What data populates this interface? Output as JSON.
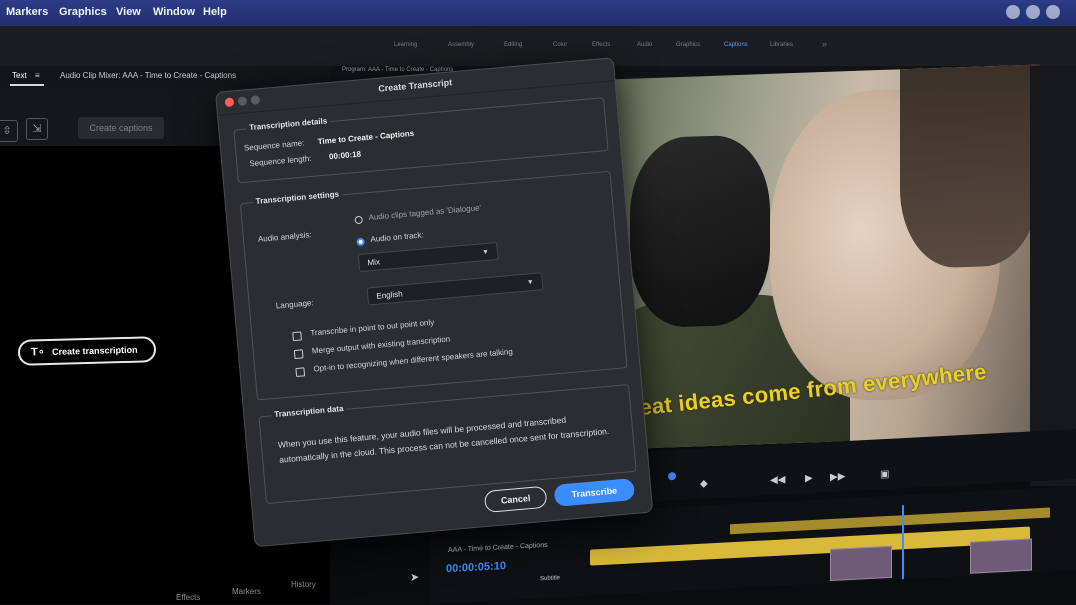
{
  "menubar": {
    "items": [
      "Markers",
      "Graphics",
      "View",
      "Window",
      "Help"
    ]
  },
  "workspace": {
    "tabs": [
      "Learning",
      "Assembly",
      "Editing",
      "Color",
      "Effects",
      "Audio",
      "Graphics",
      "Captions",
      "Libraries"
    ]
  },
  "left_panel": {
    "tab_text": "Text",
    "tab_mixer": "Audio Clip Mixer: AAA - Time to Create - Captions",
    "create_captions": "Create captions",
    "create_transcription": "Create transcription",
    "bottom_tabs": [
      "Effects",
      "Markers",
      "History"
    ]
  },
  "monitor": {
    "title": "Program: AAA - Time to Create - Captions",
    "subtitle": "Great ideas come from everywhere"
  },
  "timeline": {
    "title": "AAA - Time to Create - Captions",
    "timecode": "00:00:05:10",
    "subtitle_label": "Subtitle"
  },
  "dialog": {
    "title": "Create Transcript",
    "details": {
      "legend": "Transcription details",
      "sequence_name_label": "Sequence name:",
      "sequence_name": "Time to Create - Captions",
      "sequence_length_label": "Sequence length:",
      "sequence_length": "00:00:18"
    },
    "settings": {
      "legend": "Transcription settings",
      "audio_analysis_label": "Audio analysis:",
      "radio_dialogue": "Audio clips tagged as 'Dialogue'",
      "radio_track": "Audio on track:",
      "track_select": "Mix",
      "language_label": "Language:",
      "language_select": "English",
      "check_inout": "Transcribe in point to out point only",
      "check_merge": "Merge output with existing transcription",
      "check_speakers": "Opt-in to recognizing when different speakers are talking"
    },
    "data": {
      "legend": "Transcription data",
      "text": "When you use this feature, your audio files will be processed and transcribed automatically in the cloud. This process can not be cancelled once sent for transcription."
    },
    "cancel": "Cancel",
    "transcribe": "Transcribe"
  },
  "colors": {
    "accent": "#3a8dff",
    "menubar": "#2c3c86",
    "caption_yellow": "#e8d02a"
  }
}
